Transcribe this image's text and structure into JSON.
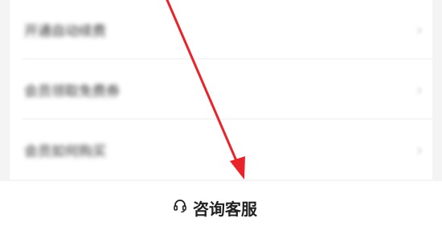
{
  "menu": {
    "items": [
      {
        "label": "开通自动续费",
        "chevron": "chevron-right-icon"
      },
      {
        "label": "会员领取免费券",
        "chevron": "chevron-right-icon"
      },
      {
        "label": "会员如何购买",
        "chevron": "chevron-right-icon"
      }
    ]
  },
  "footer": {
    "consult_label": "咨询客服",
    "consult_icon": "headset-icon"
  },
  "annotation": {
    "arrow_color": "#e8232a"
  }
}
